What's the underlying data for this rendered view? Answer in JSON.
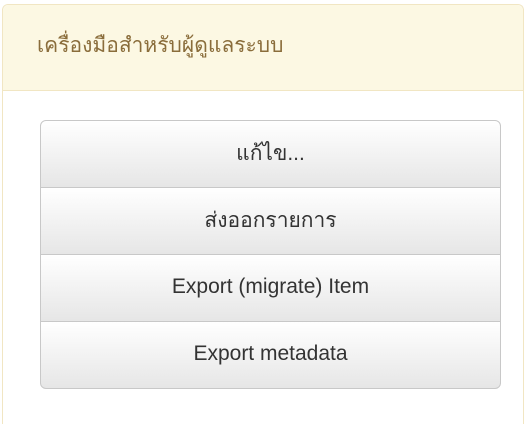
{
  "panel": {
    "title": "เครื่องมือสำหรับผู้ดูแลระบบ"
  },
  "actions": [
    {
      "label": "แก้ไข..."
    },
    {
      "label": "ส่งออกรายการ"
    },
    {
      "label": "Export (migrate) Item"
    },
    {
      "label": "Export metadata"
    }
  ]
}
